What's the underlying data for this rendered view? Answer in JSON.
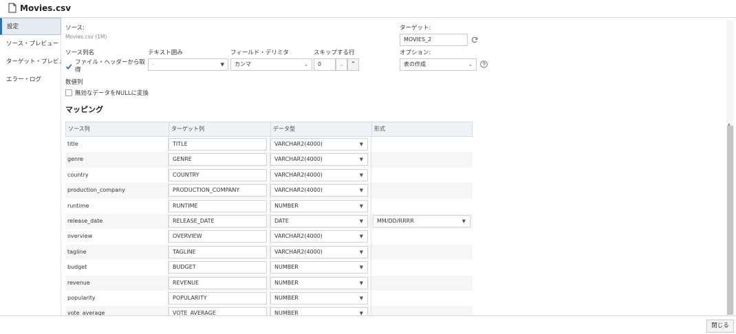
{
  "window": {
    "title": "Movies.csv"
  },
  "sidebar": {
    "items": [
      {
        "label": "設定",
        "active": true
      },
      {
        "label": "ソース・プレビュー",
        "active": false
      },
      {
        "label": "ターゲット・プレビュー",
        "active": false
      },
      {
        "label": "エラー・ログ",
        "active": false
      }
    ]
  },
  "form": {
    "source_label": "ソース:",
    "source_value": "Movies.csv (1M)",
    "target_label": "ターゲット:",
    "target_value": "MOVIES_2",
    "source_columns_label": "ソース列名",
    "header_checkbox_label": "ファイル・ヘッダーから取得",
    "header_checked": true,
    "text_enclosure_label": "テキスト囲み",
    "text_enclosure_value": "-",
    "field_delimiter_label": "フィールド・デリミタ",
    "field_delimiter_value": "カンマ",
    "skip_rows_label": "スキップする行",
    "skip_rows_value": "0",
    "options_label": "オプション:",
    "options_value": "表の作成",
    "numeric_label": "数値列",
    "null_checkbox_label": "無効なデータをNULLに変換",
    "null_checked": false
  },
  "mapping": {
    "title": "マッピング",
    "headers": [
      "ソース列",
      "ターゲット列",
      "データ型",
      "形式"
    ],
    "rows": [
      {
        "source": "title",
        "target": "TITLE",
        "type": "VARCHAR2(4000)",
        "format": ""
      },
      {
        "source": "genre",
        "target": "GENRE",
        "type": "VARCHAR2(4000)",
        "format": ""
      },
      {
        "source": "country",
        "target": "COUNTRY",
        "type": "VARCHAR2(4000)",
        "format": ""
      },
      {
        "source": "production_company",
        "target": "PRODUCTION_COMPANY",
        "type": "VARCHAR2(4000)",
        "format": ""
      },
      {
        "source": "runtime",
        "target": "RUNTIME",
        "type": "NUMBER",
        "format": ""
      },
      {
        "source": "release_date",
        "target": "RELEASE_DATE",
        "type": "DATE",
        "format": "MM/DD/RRRR"
      },
      {
        "source": "overview",
        "target": "OVERVIEW",
        "type": "VARCHAR2(4000)",
        "format": ""
      },
      {
        "source": "tagline",
        "target": "TAGLINE",
        "type": "VARCHAR2(4000)",
        "format": ""
      },
      {
        "source": "budget",
        "target": "BUDGET",
        "type": "NUMBER",
        "format": ""
      },
      {
        "source": "revenue",
        "target": "REVENUE",
        "type": "NUMBER",
        "format": ""
      },
      {
        "source": "popularity",
        "target": "POPULARITY",
        "type": "NUMBER",
        "format": ""
      },
      {
        "source": "vote_average",
        "target": "VOTE_AVERAGE",
        "type": "NUMBER",
        "format": ""
      }
    ]
  },
  "footer": {
    "close_label": "閉じる"
  },
  "colors": {
    "accent": "#2f6db5",
    "check": "#1e5ea8",
    "header_bg": "#f0f3f6"
  }
}
